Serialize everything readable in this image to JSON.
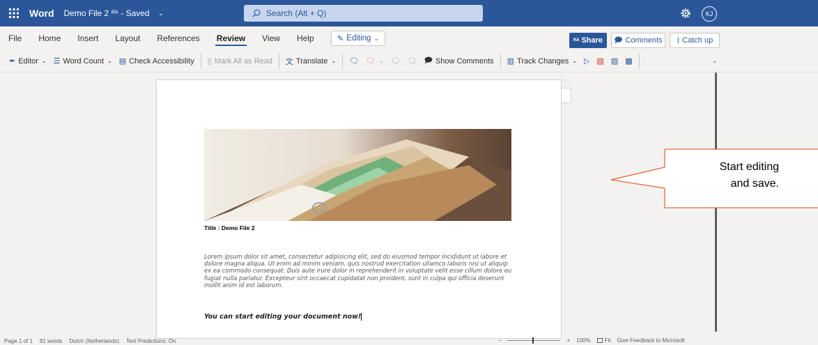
{
  "titlebar": {
    "app_name": "Word",
    "document_name": "Demo File 2",
    "status": "- Saved",
    "search_placeholder": "Search (Alt + Q)",
    "avatar_initials": "KJ",
    "brand_color": "#2b579a"
  },
  "tabs": [
    {
      "label": "File"
    },
    {
      "label": "Home"
    },
    {
      "label": "Insert"
    },
    {
      "label": "Layout"
    },
    {
      "label": "References"
    },
    {
      "label": "Review",
      "active": true
    },
    {
      "label": "View"
    },
    {
      "label": "Help"
    }
  ],
  "mode_button": {
    "label": "Editing",
    "icon": "pencil-icon"
  },
  "actions": {
    "share_label": "Share",
    "comments_label": "Comments",
    "catchup_label": "Catch up"
  },
  "ribbon": {
    "editor": "Editor",
    "word_count": "Word Count",
    "check_accessibility": "Check Accessibility",
    "mark_all_read": "Mark All as Read",
    "translate": "Translate",
    "show_comments": "Show Comments",
    "track_changes": "Track Changes"
  },
  "document": {
    "caption": "Title : Demo File 2",
    "body": "Lorem ipsum dolor sit amet, consectetur adipisicing elit, sed do eiusmod tempor incididunt ut labore et dolore magna aliqua. Ut enim ad minim veniam, quis nostrud exercitation ullamco laboris nisi ut aliquip ex ea commodo consequat. Duis aute irure dolor in reprehenderit in voluptate velit esse cillum dolore eu fugiat nulla pariatur. Excepteur sint occaecat cupidatat non proident, sunt in culpa qui officia deserunt mollit anim id est laborum.",
    "cta": "You can start editing your document now!"
  },
  "callout": {
    "line1": "Start editing",
    "line2": "and save.",
    "border_color": "#e3632d"
  },
  "statusbar": {
    "page": "Page 1 of 1",
    "words": "81 words",
    "language": "Dutch (Netherlands)",
    "predictions": "Text Predictions: On",
    "zoom": "100%",
    "fit": "Fit",
    "feedback": "Give Feedback to Microsoft"
  }
}
